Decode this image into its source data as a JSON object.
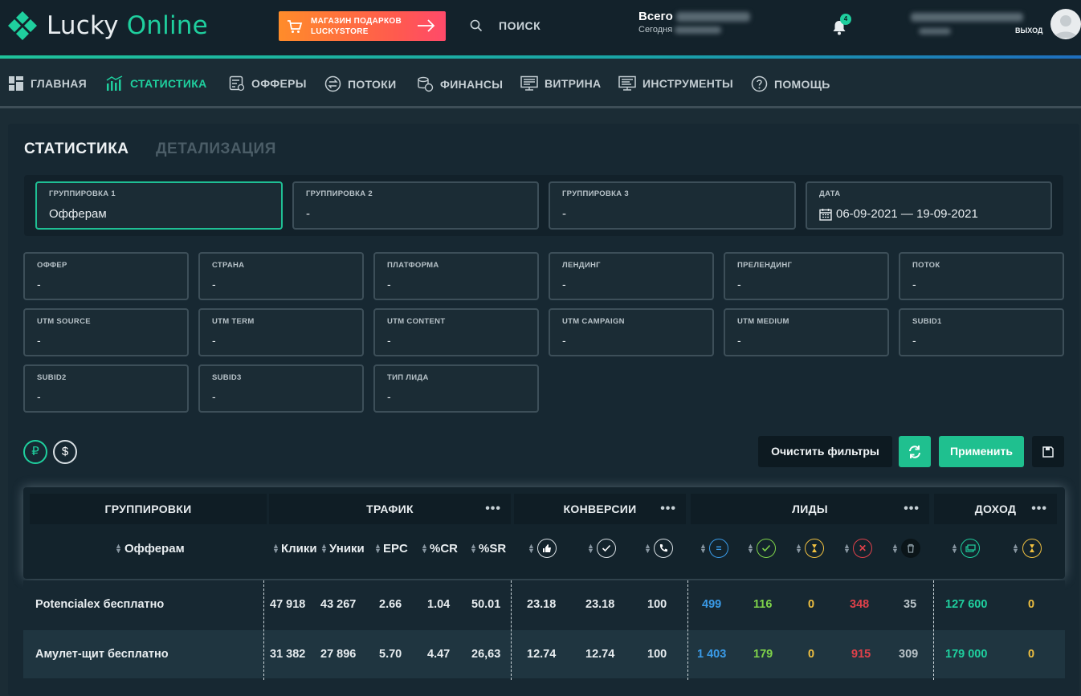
{
  "colors": {
    "accent": "#1fcf9e",
    "topbar": "#13222b",
    "panel": "#172832",
    "blue": "#3a9be8",
    "green": "#7fd34a",
    "yellow": "#f0c040",
    "red": "#e0414a"
  },
  "logo": {
    "word1": "Lucky",
    "word2": "Online"
  },
  "store": {
    "line1": "МАГАЗИН ПОДАРКОВ",
    "line2": "LUCKYSTORE"
  },
  "search": {
    "label": "ПОИСК"
  },
  "balance": {
    "title": "Всего",
    "subtitle": "Сегодня"
  },
  "notifications": {
    "count": "4"
  },
  "user": {
    "exit": "ВЫХОД"
  },
  "nav": {
    "items": [
      {
        "label": "ГЛАВНАЯ",
        "icon": "dashboard-icon"
      },
      {
        "label": "СТАТИСТИКА",
        "icon": "chart-icon"
      },
      {
        "label": "ОФФЕРЫ",
        "icon": "offers-icon"
      },
      {
        "label": "ПОТОКИ",
        "icon": "streams-icon"
      },
      {
        "label": "ФИНАНСЫ",
        "icon": "coins-icon"
      },
      {
        "label": "ВИТРИНА",
        "icon": "showcase-icon"
      },
      {
        "label": "ИНСТРУМЕНТЫ",
        "icon": "tools-icon"
      },
      {
        "label": "ПОМОЩЬ",
        "icon": "help-icon"
      }
    ]
  },
  "page": {
    "title": "СТАТИСТИКА",
    "tab2": "ДЕТАЛИЗАЦИЯ"
  },
  "groupings": [
    {
      "label": "ГРУППИРОВКА 1",
      "value": "Офферам"
    },
    {
      "label": "ГРУППИРОВКА 2",
      "value": "-"
    },
    {
      "label": "ГРУППИРОВКА 3",
      "value": "-"
    },
    {
      "label": "ДАТА",
      "value": "06-09-2021 — 19-09-2021"
    }
  ],
  "filters": [
    {
      "label": "ОФФЕР",
      "value": "-"
    },
    {
      "label": "СТРАНА",
      "value": "-"
    },
    {
      "label": "ПЛАТФОРМА",
      "value": "-"
    },
    {
      "label": "ЛЕНДИНГ",
      "value": "-"
    },
    {
      "label": "ПРЕЛЕНДИНГ",
      "value": "-"
    },
    {
      "label": "ПОТОК",
      "value": "-"
    },
    {
      "label": "UTM SOURCE",
      "value": "-"
    },
    {
      "label": "UTM TERM",
      "value": "-"
    },
    {
      "label": "UTM CONTENT",
      "value": "-"
    },
    {
      "label": "UTM CAMPAIGN",
      "value": "-"
    },
    {
      "label": "UTM MEDIUM",
      "value": "-"
    },
    {
      "label": "SUBID1",
      "value": "-"
    },
    {
      "label": "SUBID2",
      "value": "-"
    },
    {
      "label": "SUBID3",
      "value": "-"
    },
    {
      "label": "ТИП ЛИДА",
      "value": "-"
    }
  ],
  "currency": {
    "rub": "₽",
    "usd": "$"
  },
  "actions": {
    "clear": "Очистить фильтры",
    "apply": "Применить"
  },
  "table": {
    "groups": [
      {
        "label": "ГРУППИРОВКИ"
      },
      {
        "label": "ТРАФИК"
      },
      {
        "label": "КОНВЕРСИИ"
      },
      {
        "label": "ЛИДЫ"
      },
      {
        "label": "ДОХОД"
      }
    ],
    "dots": "•••",
    "sub": {
      "group": "Офферам",
      "clicks": "Клики",
      "uniques": "Уники",
      "epc": "EPC",
      "cr": "%CR",
      "sr": "%SR"
    },
    "rows": [
      {
        "name": "Potencialex бесплатно",
        "clicks": "47 918",
        "uniques": "43 267",
        "epc": "2.66",
        "cr": "1.04",
        "sr": "50.01",
        "c1": "23.18",
        "c2": "23.18",
        "c3": "100",
        "l_total": "499",
        "l_ok": "116",
        "l_hold": "0",
        "l_rej": "348",
        "l_trash": "35",
        "d_ok": "127 600",
        "d_hold": "0"
      },
      {
        "name": "Амулет-щит бесплатно",
        "clicks": "31 382",
        "uniques": "27 896",
        "epc": "5.70",
        "cr": "4.47",
        "sr": "26,63",
        "c1": "12.74",
        "c2": "12.74",
        "c3": "100",
        "l_total": "1 403",
        "l_ok": "179",
        "l_hold": "0",
        "l_rej": "915",
        "l_trash": "309",
        "d_ok": "179 000",
        "d_hold": "0"
      }
    ]
  }
}
